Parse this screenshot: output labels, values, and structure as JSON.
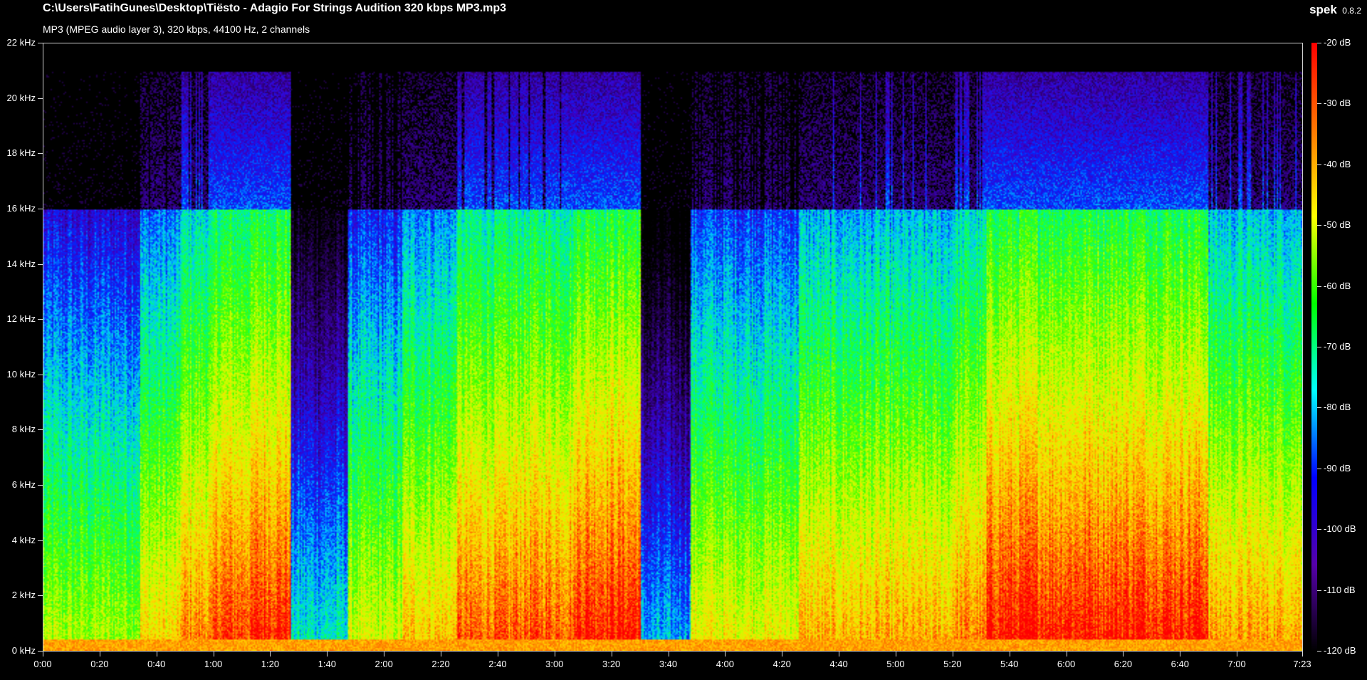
{
  "header": {
    "file_path": "C:\\Users\\FatihGunes\\Desktop\\Tiësto - Adagio For Strings Audition 320 kbps MP3.mp3",
    "file_info": "MP3 (MPEG audio layer 3), 320 kbps, 44100 Hz, 2 channels"
  },
  "app": {
    "name": "spek",
    "version": "0.8.2"
  },
  "spectrogram": {
    "lowpass_cutoff_khz": 16,
    "max_freq_khz": 22,
    "duration_seconds": 443
  },
  "freq_axis": {
    "ticks": [
      "22 kHz",
      "20 kHz",
      "18 kHz",
      "16 kHz",
      "14 kHz",
      "12 kHz",
      "10 kHz",
      "8 kHz",
      "6 kHz",
      "4 kHz",
      "2 kHz",
      "0 kHz"
    ]
  },
  "time_axis": {
    "ticks": [
      "0:00",
      "0:20",
      "0:40",
      "1:00",
      "1:20",
      "1:40",
      "2:00",
      "2:20",
      "2:40",
      "3:00",
      "3:20",
      "3:40",
      "4:00",
      "4:20",
      "4:40",
      "5:00",
      "5:20",
      "5:40",
      "6:00",
      "6:20",
      "6:40",
      "7:00",
      "7:23"
    ]
  },
  "db_scale": {
    "ticks": [
      "-20 dB",
      "-30 dB",
      "-40 dB",
      "-50 dB",
      "-60 dB",
      "-70 dB",
      "-80 dB",
      "-90 dB",
      "-100 dB",
      "-110 dB",
      "-120 dB"
    ],
    "colors": [
      "#ff0000",
      "#ff7700",
      "#ffff00",
      "#00ff00",
      "#00ffff",
      "#0000ff",
      "#5500aa",
      "#000000"
    ]
  }
}
